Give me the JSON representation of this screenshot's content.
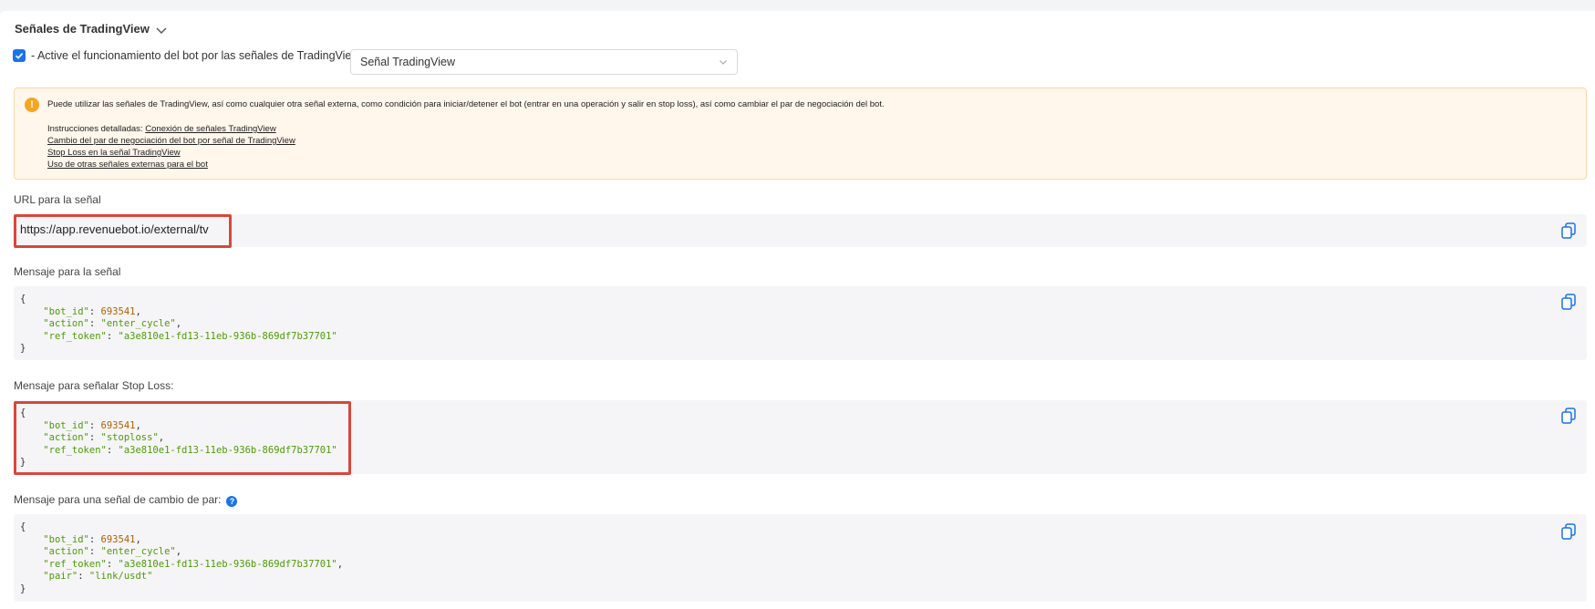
{
  "section": {
    "title": "Señales de TradingView"
  },
  "activation": {
    "checked": true,
    "label": "- Active el funcionamiento del bot por las señales de TradingView",
    "select_value": "Señal TradingView"
  },
  "alert": {
    "text": "Puede utilizar las señales de TradingView, así como cualquier otra señal externa, como condición para iniciar/detener el bot (entrar en una operación y salir en stop loss), así como cambiar el par de negociación del bot.",
    "instructions_prefix": "Instrucciones detalladas:",
    "links": [
      "Conexión de señales TradingView",
      "Cambio del par de negociación del bot por señal de TradingView",
      "Stop Loss en la señal TradingView",
      "Uso de otras señales externas para el bot"
    ]
  },
  "url_field": {
    "label": "URL para la señal",
    "value": "https://app.revenuebot.io/external/tv"
  },
  "message": {
    "label": "Mensaje para la señal",
    "bot_id": "693541",
    "action": "enter_cycle",
    "ref_token": "a3e810e1-fd13-11eb-936b-869df7b37701"
  },
  "stoploss": {
    "label": "Mensaje para señalar Stop Loss:",
    "bot_id": "693541",
    "action": "stoploss",
    "ref_token": "a3e810e1-fd13-11eb-936b-869df7b37701"
  },
  "pair_change": {
    "label": "Mensaje para una señal de cambio de par:",
    "bot_id": "693541",
    "action": "enter_cycle",
    "ref_token": "a3e810e1-fd13-11eb-936b-869df7b37701",
    "pair": "link/usdt"
  },
  "colors": {
    "accent": "#1a73e8",
    "highlight": "#d9463c",
    "alert_bg": "#fff6ec",
    "warning": "#f5a623"
  },
  "icons": {
    "copy": "copy-icon",
    "help": "help-icon",
    "warning": "warning-icon",
    "chevron": "chevron-down-icon"
  }
}
